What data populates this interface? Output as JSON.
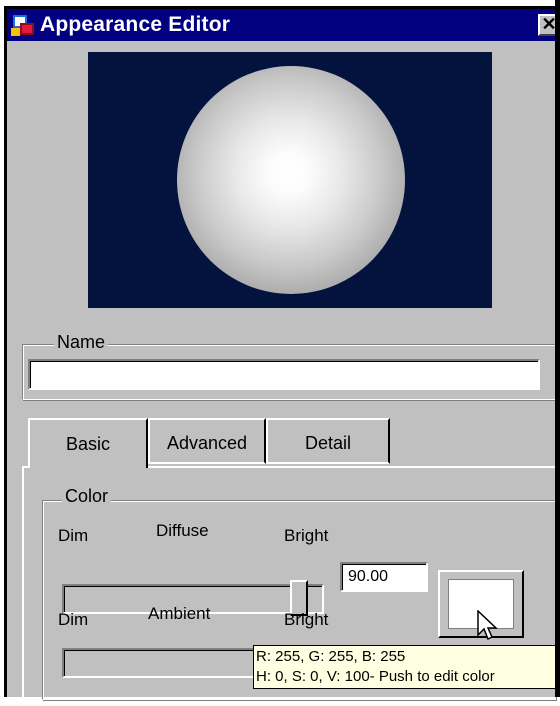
{
  "window": {
    "title": "Appearance Editor",
    "close_glyph": "✕",
    "icon": "appearance-editor-app-icon"
  },
  "preview": {
    "background_color": "#03133d",
    "sphere_color": "#ffffff"
  },
  "name_group": {
    "legend": "Name",
    "value": "",
    "placeholder": ""
  },
  "tabs": [
    {
      "label": "Basic",
      "selected": true
    },
    {
      "label": "Advanced",
      "selected": false
    },
    {
      "label": "Detail",
      "selected": false
    }
  ],
  "color_group": {
    "legend": "Color",
    "diffuse": {
      "dim_label": "Dim",
      "name": "Diffuse",
      "bright_label": "Bright",
      "value": "90.00",
      "slider_level": 0.9
    },
    "ambient": {
      "dim_label": "Dim",
      "name": "Ambient",
      "bright_label": "Bright"
    },
    "swatch_color": "#ffffff"
  },
  "tooltip": {
    "line1": "R: 255, G: 255, B: 255",
    "line2": "H: 0, S: 0, V: 100- Push to edit color"
  },
  "colors": {
    "titlebar": "#000080",
    "face": "#c0c0c0",
    "tooltip_bg": "#ffffe1"
  }
}
